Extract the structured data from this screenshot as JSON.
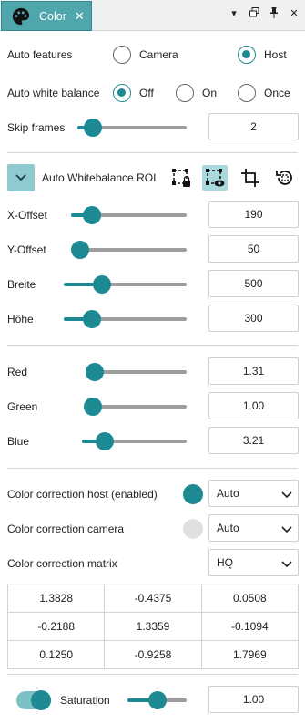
{
  "titlebar": {
    "tab_label": "Color",
    "tab_close": "✕",
    "buttons": {
      "menu": "▾",
      "float": "🗗",
      "pin": "📌",
      "close": "✕"
    }
  },
  "auto_features": {
    "label": "Auto features",
    "options": [
      "Camera",
      "Host"
    ],
    "selected": "Host"
  },
  "auto_white_balance": {
    "label": "Auto white balance",
    "options": [
      "Off",
      "On",
      "Once"
    ],
    "selected": "Off"
  },
  "skip_frames": {
    "label": "Skip frames",
    "value": "2",
    "slider_fraction": 0.07
  },
  "roi": {
    "expand_icon": "chevron-down",
    "label": "Auto Whitebalance ROI",
    "icons": [
      "roi-lock-icon",
      "roi-visible-icon",
      "crop-icon",
      "reset-rotate-icon"
    ],
    "active_icon": "roi-visible-icon",
    "fields": [
      {
        "label": "X-Offset",
        "value": "190",
        "slider_fraction": 0.12
      },
      {
        "label": "Y-Offset",
        "value": "50",
        "slider_fraction": 0.0
      },
      {
        "label": "Breite",
        "value": "500",
        "slider_fraction": 0.28
      },
      {
        "label": "Höhe",
        "value": "300",
        "slider_fraction": 0.18
      }
    ]
  },
  "gains": [
    {
      "label": "Red",
      "value": "1.31",
      "slider_fraction": 0.0
    },
    {
      "label": "Green",
      "value": "1.00",
      "slider_fraction": 0.0
    },
    {
      "label": "Blue",
      "value": "3.21",
      "slider_fraction": 0.16
    }
  ],
  "color_correction": {
    "host": {
      "label": "Color correction host (enabled)",
      "value": "Auto",
      "enabled": true
    },
    "camera": {
      "label": "Color correction camera",
      "value": "Auto",
      "enabled": false
    },
    "matrix_label": "Color correction matrix",
    "matrix_preset": "HQ",
    "matrix": [
      [
        "1.3828",
        "-0.4375",
        "0.0508"
      ],
      [
        "-0.2188",
        "1.3359",
        "-0.1094"
      ],
      [
        "0.1250",
        "-0.9258",
        "1.7969"
      ]
    ]
  },
  "saturation": {
    "label": "Saturation",
    "value": "1.00",
    "toggle_on": true,
    "slider_fraction": 0.5
  },
  "colors": {
    "accent": "#1d8a93",
    "tab": "#4fa7ad",
    "track": "#9e9e9e"
  }
}
